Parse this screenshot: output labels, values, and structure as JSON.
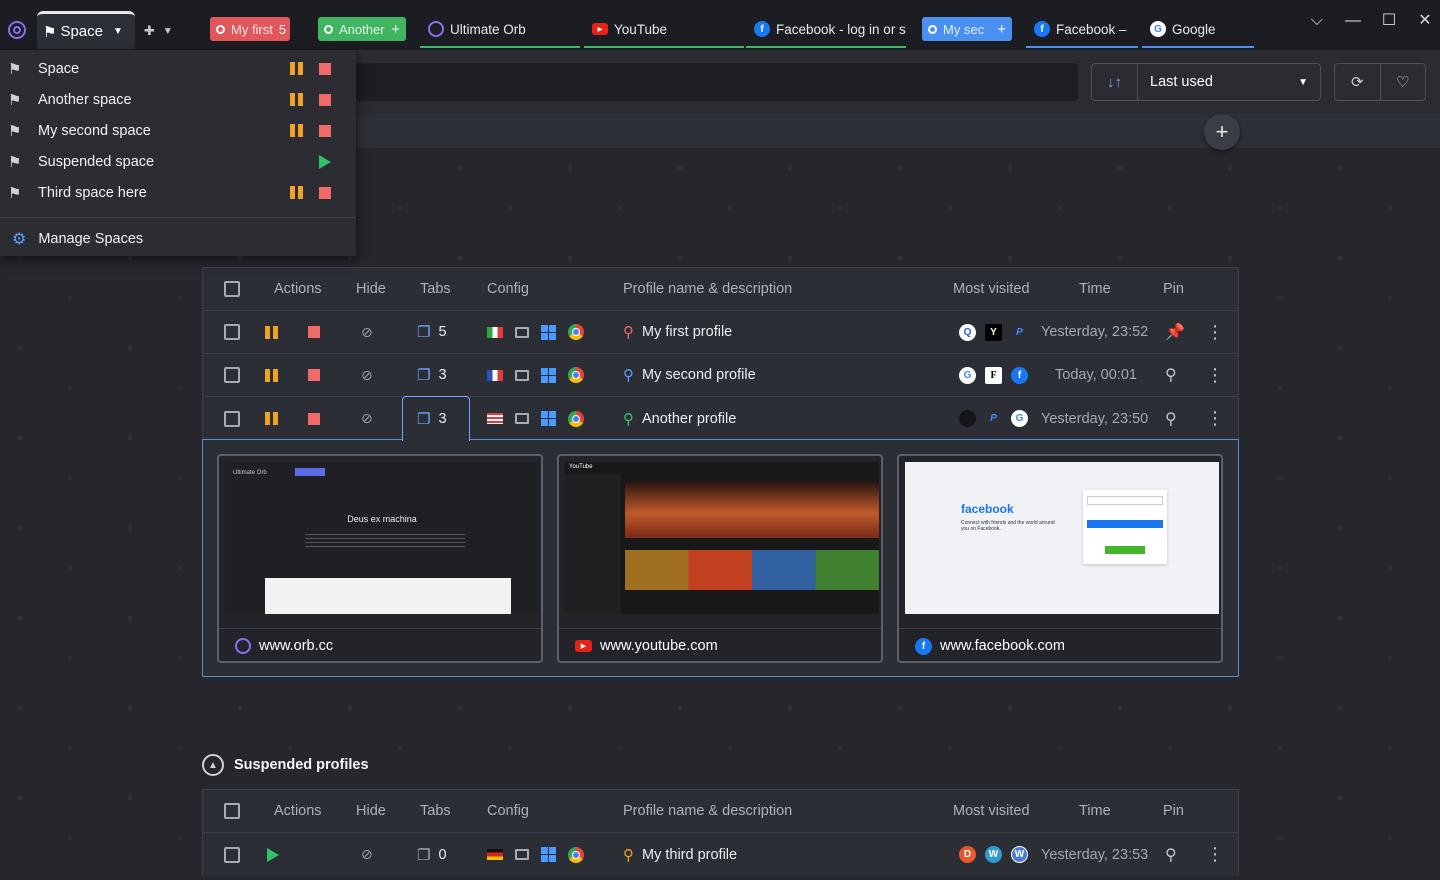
{
  "titlebar": {
    "space_label": "Space",
    "tabs": [
      {
        "label": "My first",
        "badge": "5",
        "color": "#e2575b",
        "kind": "profile"
      },
      {
        "label": "Another",
        "badge": "+",
        "color": "#3fb562",
        "kind": "profile"
      },
      {
        "label": "Ultimate Orb",
        "kind": "site",
        "icon": "orb-icon"
      },
      {
        "label": "YouTube",
        "kind": "site",
        "icon": "youtube-icon"
      },
      {
        "label": "Facebook - log in or s",
        "kind": "site",
        "icon": "facebook-icon"
      },
      {
        "label": "My sec",
        "badge": "+",
        "color": "#4a90f0",
        "kind": "profile"
      },
      {
        "label": "Facebook –",
        "kind": "site",
        "icon": "facebook-icon"
      },
      {
        "label": "Google",
        "kind": "site",
        "icon": "google-icon"
      }
    ]
  },
  "toolbar": {
    "search_placeholder": "",
    "sort_label": "Last used"
  },
  "space_menu": {
    "items": [
      {
        "label": "Space",
        "state": "running"
      },
      {
        "label": "Another space",
        "state": "running"
      },
      {
        "label": "My second space",
        "state": "running"
      },
      {
        "label": "Suspended space",
        "state": "suspended"
      },
      {
        "label": "Third space here",
        "state": "running"
      }
    ],
    "manage_label": "Manage Spaces"
  },
  "table_headers": {
    "actions": "Actions",
    "hide": "Hide",
    "tabs": "Tabs",
    "config": "Config",
    "profile": "Profile name & description",
    "visited": "Most visited",
    "time": "Time",
    "pin": "Pin"
  },
  "profiles": [
    {
      "name": "My first profile",
      "tabs": "5",
      "time": "Yesterday, 23:52",
      "pinned": true,
      "flag": "italy",
      "person_color": "#f06a6a"
    },
    {
      "name": "My second profile",
      "tabs": "3",
      "time": "Today, 00:01",
      "pinned": false,
      "flag": "france",
      "person_color": "#5aa1ff"
    },
    {
      "name": "Another profile",
      "tabs": "3",
      "time": "Yesterday, 23:50",
      "pinned": false,
      "flag": "usa",
      "person_color": "#3fc26f"
    }
  ],
  "previews": [
    {
      "url": "www.orb.cc",
      "icon": "orb-icon",
      "thumb_title": "Deus ex machina",
      "thumb_brand": "Ultimate Orb"
    },
    {
      "url": "www.youtube.com",
      "icon": "youtube-icon",
      "thumb_title": "YouTube",
      "thumb_brand": "YouTube"
    },
    {
      "url": "www.facebook.com",
      "icon": "facebook-icon",
      "thumb_title": "facebook",
      "thumb_brand": "Connect with friends and the world around you on Facebook."
    }
  ],
  "suspended_section": {
    "title": "Suspended profiles",
    "profiles": [
      {
        "name": "My third profile",
        "tabs": "0",
        "time": "Yesterday, 23:53",
        "flag": "germany",
        "person_color": "#f0a227"
      }
    ]
  },
  "colors": {
    "accent_blue": "#6fa6ff",
    "pause_orange": "#f0a227",
    "stop_red": "#f06a6a",
    "play_green": "#2ec26a"
  }
}
